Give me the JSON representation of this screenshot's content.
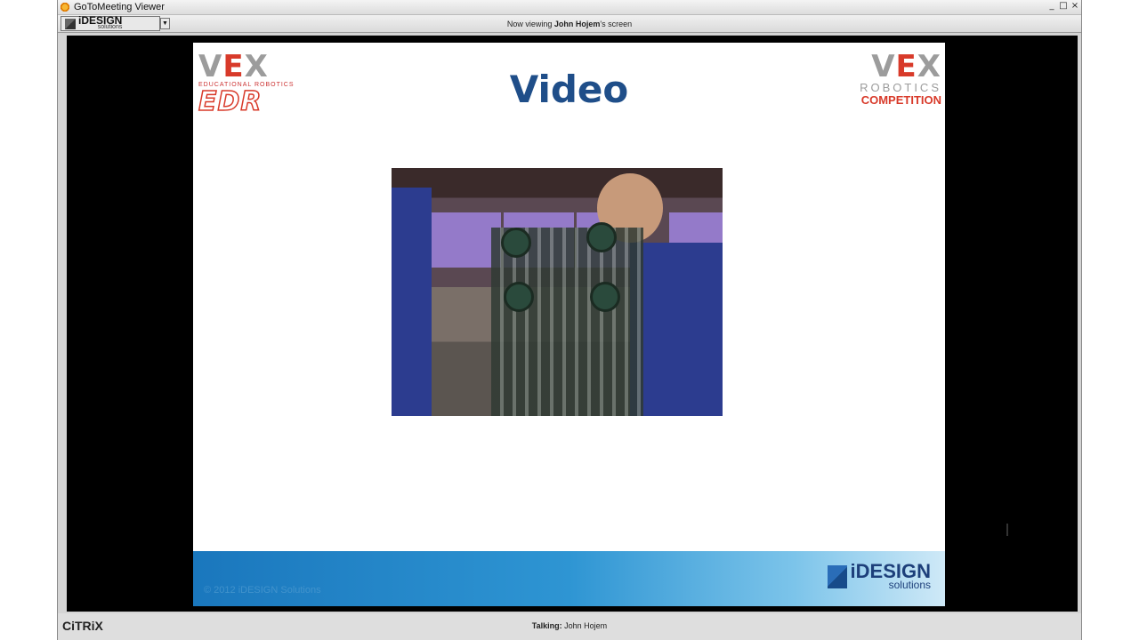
{
  "window": {
    "title": "GoToMeeting Viewer",
    "controls": [
      "_",
      "□",
      "×"
    ]
  },
  "toolbar": {
    "brand_main": "iDESIGN",
    "brand_sub": "solutions",
    "dropdown": "▼",
    "viewing_prefix": "Now viewing ",
    "viewing_name": "John Hojem",
    "viewing_suffix": "'s screen"
  },
  "slide": {
    "title": "Video",
    "left_logo": {
      "vex_v": "V",
      "vex_e": "E",
      "vex_x": "X",
      "tagline": "EDUCATIONAL ROBOTICS",
      "edr": "EDR"
    },
    "right_logo": {
      "vex_v": "V",
      "vex_e": "E",
      "vex_x": "X",
      "robotics": "ROBOTICS",
      "competition": "COMPETITION"
    },
    "footer_copy": "© 2012 iDESIGN Solutions",
    "footer_brand_main": "iDESIGN",
    "footer_brand_sub": "solutions"
  },
  "statusbar": {
    "citrix": "CiTRiX",
    "talking_label": "Talking:",
    "talking_name": "John Hojem"
  }
}
